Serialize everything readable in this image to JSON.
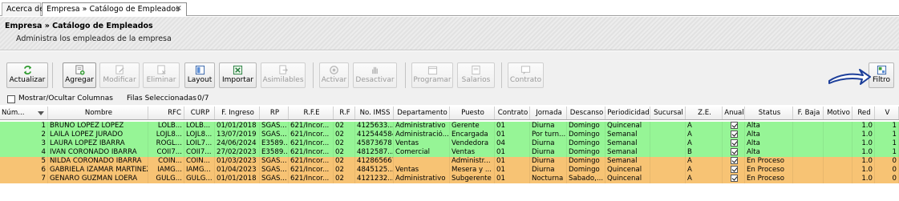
{
  "tabs": [
    {
      "label": "Acerca de"
    },
    {
      "label": "Empresa » Catálogo de Empleados",
      "close": "×"
    }
  ],
  "header": {
    "title": "Empresa » Catálogo de Empleados",
    "subtitle": "Administra los empleados de la empresa"
  },
  "toolbar": {
    "actualizar": "Actualizar",
    "agregar": "Agregar",
    "modificar": "Modificar",
    "eliminar": "Eliminar",
    "layout": "Layout",
    "importar": "Importar",
    "asimilables": "Asimilables",
    "activar": "Activar",
    "desactivar": "Desactivar",
    "programar": "Programar",
    "salarios": "Salarios",
    "contrato": "Contrato",
    "filtro": "Filtro"
  },
  "options": {
    "show_columns": "Mostrar/Ocultar Columnas",
    "selected_label": "Filas Seleccionadas",
    "selected_value": "0/7"
  },
  "colors": {
    "active_row": "#96f596",
    "process_row": "#f7c374",
    "arrow": "#1d3f9a"
  },
  "table": {
    "columns": [
      "Núm...",
      "Nombre",
      "RFC",
      "CURP",
      "F. Ingreso",
      "RP",
      "R.F.E",
      "R.F",
      "No. IMSS",
      "Departamento",
      "Puesto",
      "Contrato",
      "Jornada",
      "Descanso",
      "Periodicidad",
      "Sucursal",
      "Z.E.",
      "Anual",
      "Status",
      "F. Baja",
      "Motivo",
      "Red",
      "V"
    ],
    "rows": [
      {
        "num": "1",
        "nombre": "BRUNO LOPEZ LOPEZ",
        "rfc": "LOLB...",
        "curp": "LOLB...",
        "ingreso": "01/01/2018",
        "rp": "SGAS...",
        "rfe": "621/Incor...",
        "rf": "02",
        "imss": "4125633...",
        "depto": "Administrativo",
        "puesto": "Gerente",
        "contrato": "01",
        "jornada": "Diurna",
        "descanso": "Domingo",
        "periodicidad": "Quincenal",
        "sucursal": "",
        "ze": "A",
        "status": "Alta",
        "baja": "",
        "motivo": "",
        "red": "1.0",
        "v": "1"
      },
      {
        "num": "2",
        "nombre": "LAILA LOPEZ JURADO",
        "rfc": "LOJL8...",
        "curp": "LOJL8...",
        "ingreso": "13/07/2019",
        "rp": "SGAS...",
        "rfe": "621/Incor...",
        "rf": "02",
        "imss": "412544584",
        "depto": "Administració...",
        "puesto": "Encargada",
        "contrato": "01",
        "jornada": "Por turn...",
        "descanso": "Domingo",
        "periodicidad": "Semanal",
        "sucursal": "",
        "ze": "A",
        "status": "Alta",
        "baja": "",
        "motivo": "",
        "red": "1.0",
        "v": "1"
      },
      {
        "num": "3",
        "nombre": "LAURA LOPEZ IBARRA",
        "rfc": "ROGL...",
        "curp": "LOIL7...",
        "ingreso": "24/06/2024",
        "rp": "E3589...",
        "rfe": "621/Incor...",
        "rf": "02",
        "imss": "45873678",
        "depto": "Ventas",
        "puesto": "Vendedora",
        "contrato": "04",
        "jornada": "Diurna",
        "descanso": "Domingo",
        "periodicidad": "Semanal",
        "sucursal": "",
        "ze": "A",
        "status": "Alta",
        "baja": "",
        "motivo": "",
        "red": "1.0",
        "v": "1"
      },
      {
        "num": "4",
        "nombre": "IVAN CORONADO IBARRA",
        "rfc": "COII7...",
        "curp": "COII7...",
        "ingreso": "27/02/2023",
        "rp": "E3589...",
        "rfe": "621/Incor...",
        "rf": "02",
        "imss": "4812587...",
        "depto": "Comercial",
        "puesto": "Ventas",
        "contrato": "01",
        "jornada": "Diurna",
        "descanso": "Domingo",
        "periodicidad": "Semanal",
        "sucursal": "",
        "ze": "B",
        "status": "Alta",
        "baja": "",
        "motivo": "",
        "red": "1.0",
        "v": "1"
      },
      {
        "num": "5",
        "nombre": "NILDA CORONADO IBARRA",
        "rfc": "COIN...",
        "curp": "COIN...",
        "ingreso": "01/03/2023",
        "rp": "SGAS...",
        "rfe": "621/Incor...",
        "rf": "02",
        "imss": "412865667",
        "depto": "",
        "puesto": "Administr...",
        "contrato": "01",
        "jornada": "Diurna",
        "descanso": "Domingo",
        "periodicidad": "Semanal",
        "sucursal": "",
        "ze": "A",
        "status": "En Proceso",
        "baja": "",
        "motivo": "",
        "red": "1.0",
        "v": "0"
      },
      {
        "num": "6",
        "nombre": "GABRIELA IZAMAR MARTINEZ",
        "rfc": "IAMG...",
        "curp": "IAMG...",
        "ingreso": "01/04/2023",
        "rp": "SGAS...",
        "rfe": "621/Incor...",
        "rf": "02",
        "imss": "4845125...",
        "depto": "Ventas",
        "puesto": "Mesera y ...",
        "contrato": "01",
        "jornada": "Diurna",
        "descanso": "Domingo",
        "periodicidad": "Quincenal",
        "sucursal": "",
        "ze": "A",
        "status": "En Proceso",
        "baja": "",
        "motivo": "",
        "red": "1.0",
        "v": "0"
      },
      {
        "num": "7",
        "nombre": "GENARO GUZMAN LOERA",
        "rfc": "GULG...",
        "curp": "GULG...",
        "ingreso": "01/01/2018",
        "rp": "SGAS...",
        "rfe": "621/Incor...",
        "rf": "02",
        "imss": "4121232...",
        "depto": "Administrativo",
        "puesto": "Subgerente",
        "contrato": "01",
        "jornada": "Nocturna",
        "descanso": "Sabado,...",
        "periodicidad": "Quincenal",
        "sucursal": "",
        "ze": "A",
        "status": "En Proceso",
        "baja": "",
        "motivo": "",
        "red": "1.0",
        "v": "0"
      }
    ]
  }
}
